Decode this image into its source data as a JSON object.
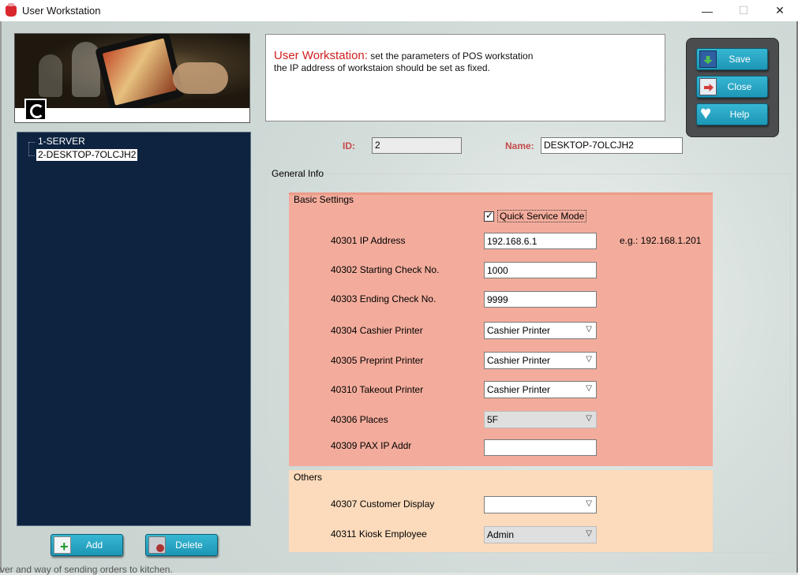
{
  "window": {
    "title": "User Workstation",
    "minimize": "—",
    "maximize": "☐",
    "close": "✕"
  },
  "info": {
    "title": "User Workstation:",
    "line1": " set the parameters of POS workstation",
    "line2": "the IP address of workstaion should be set as fixed."
  },
  "tree": {
    "items": [
      "1-SERVER",
      "2-DESKTOP-7OLCJH2"
    ]
  },
  "left_buttons": {
    "add": "Add",
    "delete": "Delete"
  },
  "actions": {
    "save": "Save",
    "close": "Close",
    "help": "Help"
  },
  "header": {
    "id_label": "ID:",
    "id_value": "2",
    "name_label": "Name:",
    "name_value": "DESKTOP-7OLCJH2"
  },
  "general_info": "General Info",
  "basic": {
    "legend": "Basic Settings",
    "quick_service": {
      "label": "Quick Service Mode",
      "checked": true
    },
    "ip_label": "40301 IP Address",
    "ip_value": "192.168.6.1",
    "ip_hint": "e.g.: 192.168.1.201",
    "start_label": "40302 Starting Check No.",
    "start_value": "1000",
    "end_label": "40303 Ending Check No.",
    "end_value": "9999",
    "cashier_label": "40304 Cashier Printer",
    "cashier_value": "Cashier Printer",
    "preprint_label": "40305 Preprint Printer",
    "preprint_value": "Cashier Printer",
    "takeout_label": "40310 Takeout Printer",
    "takeout_value": "Cashier Printer",
    "places_label": "40306 Places",
    "places_value": "5F",
    "pax_label": "40309 PAX IP Addr",
    "pax_value": ""
  },
  "others": {
    "legend": "Others",
    "display_label": "40307 Customer Display",
    "display_value": "",
    "kiosk_label": "40311 Kiosk Employee",
    "kiosk_value": "Admin"
  },
  "background_text": "ver and way of sending orders to kitchen.",
  "colors": {
    "basic_bg": "#f3ac9c",
    "others_bg": "#fcdbbc",
    "tree_bg": "#0d2340",
    "button_teal": "#2aa8c6",
    "title_red": "#d01f1f"
  }
}
